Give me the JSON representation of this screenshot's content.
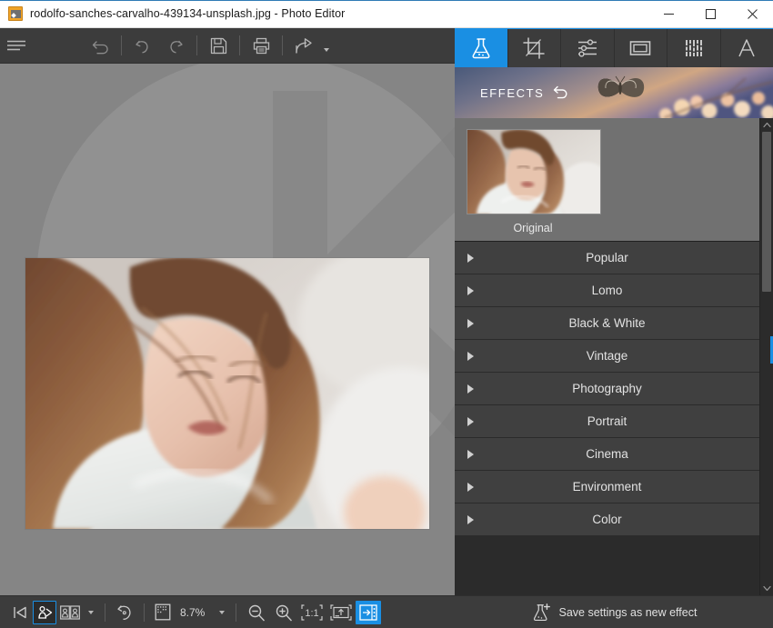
{
  "window": {
    "title": "rodolfo-sanches-carvalho-439134-unsplash.jpg - Photo Editor",
    "app_icon": "photo-editor-icon",
    "minimize_label": "Minimize",
    "maximize_label": "Maximize",
    "close_label": "Close",
    "accent_color": "#1a8fe3",
    "titlebar_bg": "#ffffff",
    "chrome_bg": "#3c3c3c",
    "panel_bg": "#2b2b2b"
  },
  "toolbar": {
    "menu_label": "Menu",
    "revert_label": "Revert to original",
    "undo_label": "Undo",
    "redo_label": "Redo",
    "save_label": "Save",
    "print_label": "Print",
    "share_label": "Share",
    "share_caret": "chevron-down-icon"
  },
  "canvas": {
    "zoom_percent": "8.7%",
    "image_alt": "Portrait photo of a woman with long brown hair looking down",
    "watermark": "photo-editor-watermark",
    "canvas_bg": "#858585"
  },
  "statusbar": {
    "previous_image_label": "Previous image",
    "slideshow_label": "Slideshow",
    "compare_label": "Compare before and after",
    "compare_caret": "chevron-down-icon",
    "rotate_label": "Rotate",
    "zoom_level_icon": "zoom-level-icon",
    "zoom_value": "8.7%",
    "zoom_caret": "chevron-down-icon",
    "zoom_out_label": "Zoom out",
    "zoom_in_label": "Zoom in",
    "actual_size_label": "1:1",
    "fit_to_window_label": "Fit to window",
    "toggle_panel_label": "Show / hide panel"
  },
  "tabs": [
    {
      "id": "effects",
      "icon": "flask-icon",
      "label": "Effects",
      "active": true
    },
    {
      "id": "crop",
      "icon": "crop-icon",
      "label": "Crop",
      "active": false
    },
    {
      "id": "adjust",
      "icon": "sliders-icon",
      "label": "Adjust",
      "active": false
    },
    {
      "id": "frame",
      "icon": "frame-icon",
      "label": "Frame",
      "active": false
    },
    {
      "id": "texture",
      "icon": "texture-icon",
      "label": "Texture",
      "active": false
    },
    {
      "id": "text",
      "icon": "text-a-icon",
      "label": "Text",
      "active": false
    }
  ],
  "effects_panel": {
    "header_title": "EFFECTS",
    "header_reset_icon": "reset-arrow-icon",
    "banner_art": "butterfly-blossom-banner",
    "original": {
      "label": "Original",
      "thumb_alt": "Original photo thumbnail"
    },
    "categories": [
      {
        "label": "Popular",
        "expanded": false
      },
      {
        "label": "Lomo",
        "expanded": false
      },
      {
        "label": "Black & White",
        "expanded": false
      },
      {
        "label": "Vintage",
        "expanded": false
      },
      {
        "label": "Photography",
        "expanded": false
      },
      {
        "label": "Portrait",
        "expanded": false
      },
      {
        "label": "Cinema",
        "expanded": false
      },
      {
        "label": "Environment",
        "expanded": false
      },
      {
        "label": "Color",
        "expanded": false
      }
    ],
    "scrollbar": {
      "up_icon": "chevron-up-icon",
      "down_icon": "chevron-down-icon"
    },
    "footer": {
      "icon": "flask-plus-icon",
      "label": "Save settings as new effect"
    }
  }
}
